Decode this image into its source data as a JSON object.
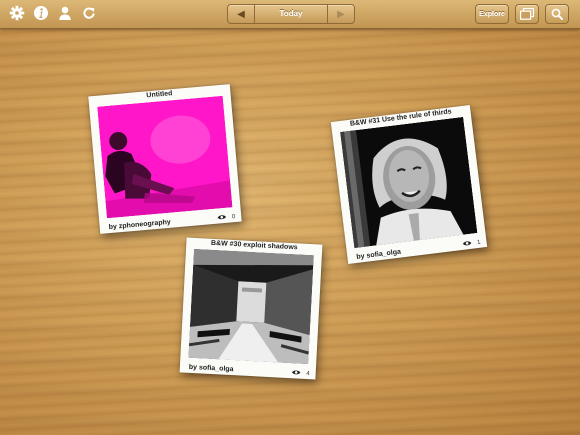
{
  "toolbar": {
    "left_icons": [
      "gear-icon",
      "info-icon",
      "person-icon",
      "refresh-icon"
    ],
    "nav": {
      "prev": "◀",
      "label": "Today",
      "next": "▶"
    },
    "explore_label": "Explore",
    "right_icons": [
      "gallery-icon",
      "search-icon"
    ]
  },
  "photos": [
    {
      "title": "Untitled",
      "author": "by zphoneography",
      "views": "0",
      "colors": {
        "main": "#ff16c8"
      }
    },
    {
      "title": "B&W #31 Use the rule of thirds",
      "author": "by sofia_olga",
      "views": "1"
    },
    {
      "title": "B&W #30 exploit shadows",
      "author": "by sofia_olga",
      "views": "4"
    }
  ],
  "colors": {
    "wood": "#cf9d55",
    "toolbar": "#d2aa66",
    "magenta": "#ff16c8"
  }
}
